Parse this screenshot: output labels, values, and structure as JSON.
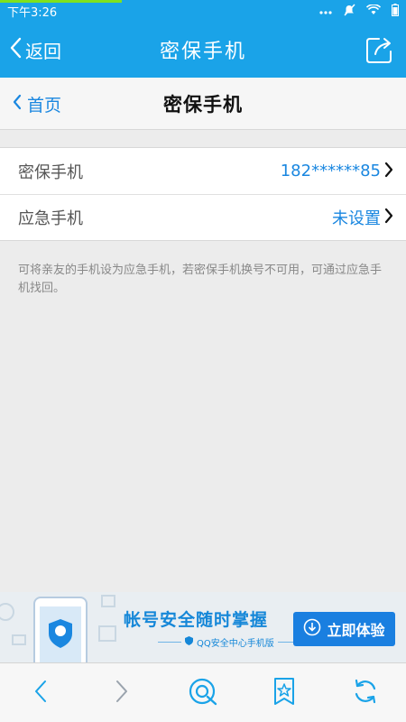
{
  "status_bar": {
    "time": "下午3:26",
    "battery": ""
  },
  "title_bar": {
    "back_label": "返回",
    "title": "密保手机"
  },
  "sub_header": {
    "home_label": "首页",
    "title": "密保手机"
  },
  "settings": [
    {
      "label": "密保手机",
      "value": "182******85"
    },
    {
      "label": "应急手机",
      "value": "未设置"
    }
  ],
  "hint": "可将亲友的手机设为应急手机，若密保手机换号不可用，可通过应急手机找回。",
  "banner": {
    "headline": "帐号安全随时掌握",
    "subline": "QQ安全中心手机版",
    "cta_label": "立即体验"
  },
  "colors": {
    "accent": "#1aa3e8",
    "link": "#1a87e0",
    "progress": "#7fe11e"
  }
}
